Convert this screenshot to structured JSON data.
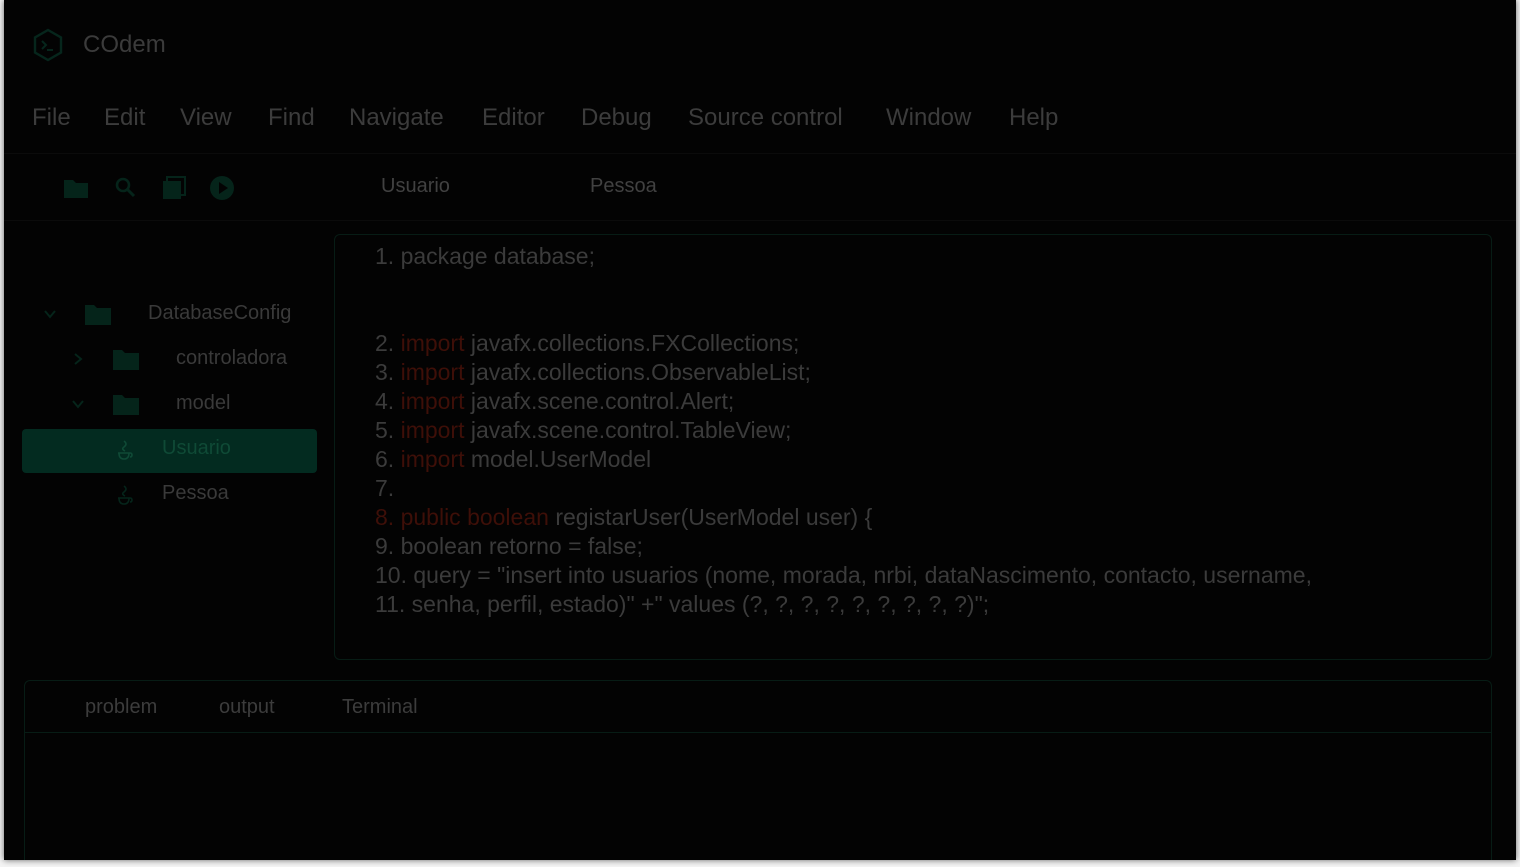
{
  "app": {
    "title": "COdem"
  },
  "menu": [
    "File",
    "Edit",
    "View",
    "Find",
    "Navigate",
    "Editor",
    "Debug",
    "Source control",
    "Window",
    "Help"
  ],
  "toolbar": {
    "icons": [
      "folder-icon",
      "search-icon",
      "files-icon",
      "run-icon"
    ],
    "tabs": [
      "Usuario",
      "Pessoa"
    ]
  },
  "explorer": {
    "items": [
      {
        "label": "DatabaseConfig",
        "type": "folder",
        "expanded": true
      },
      {
        "label": "controladora",
        "type": "folder",
        "expanded": false
      },
      {
        "label": "model",
        "type": "folder",
        "expanded": true
      },
      {
        "label": "Usuario",
        "type": "java-file",
        "selected": true
      },
      {
        "label": "Pessoa",
        "type": "java-file",
        "selected": false
      }
    ]
  },
  "editor": {
    "lines": [
      {
        "num": "1.",
        "kw": "",
        "text": "package database;"
      },
      {
        "num": "2.",
        "kw": "import",
        "text": "javafx.collections.FXCollections;"
      },
      {
        "num": "3.",
        "kw": "import",
        "text": "javafx.collections.ObservableList;"
      },
      {
        "num": "4.",
        "kw": "import",
        "text": "javafx.scene.control.Alert;"
      },
      {
        "num": "5.",
        "kw": "import",
        "text": "javafx.scene.control.TableView;"
      },
      {
        "num": "6.",
        "kw": "import",
        "text": "model.UserModel"
      },
      {
        "num": "7.",
        "kw": "",
        "text": ""
      },
      {
        "num": "8.",
        "kw": "public boolean",
        "text": "registarUser(UserModel user) {"
      },
      {
        "num": "9.",
        "kw": "",
        "text": "boolean retorno = false;"
      },
      {
        "num": "10.",
        "kw": "",
        "text": "query = \"insert into usuarios (nome, morada, nrbi, dataNascimento, contacto, username,"
      },
      {
        "num": "11.",
        "kw": "",
        "text": "senha, perfil, estado)\" +\" values (?, ?, ?, ?, ?, ?, ?, ?, ?)\";"
      }
    ]
  },
  "panel": {
    "tabs": [
      "problem",
      "output",
      "Terminal"
    ]
  },
  "colors": {
    "accent": "#032b20",
    "keyword": "#3e0f08",
    "background": "#030303"
  }
}
